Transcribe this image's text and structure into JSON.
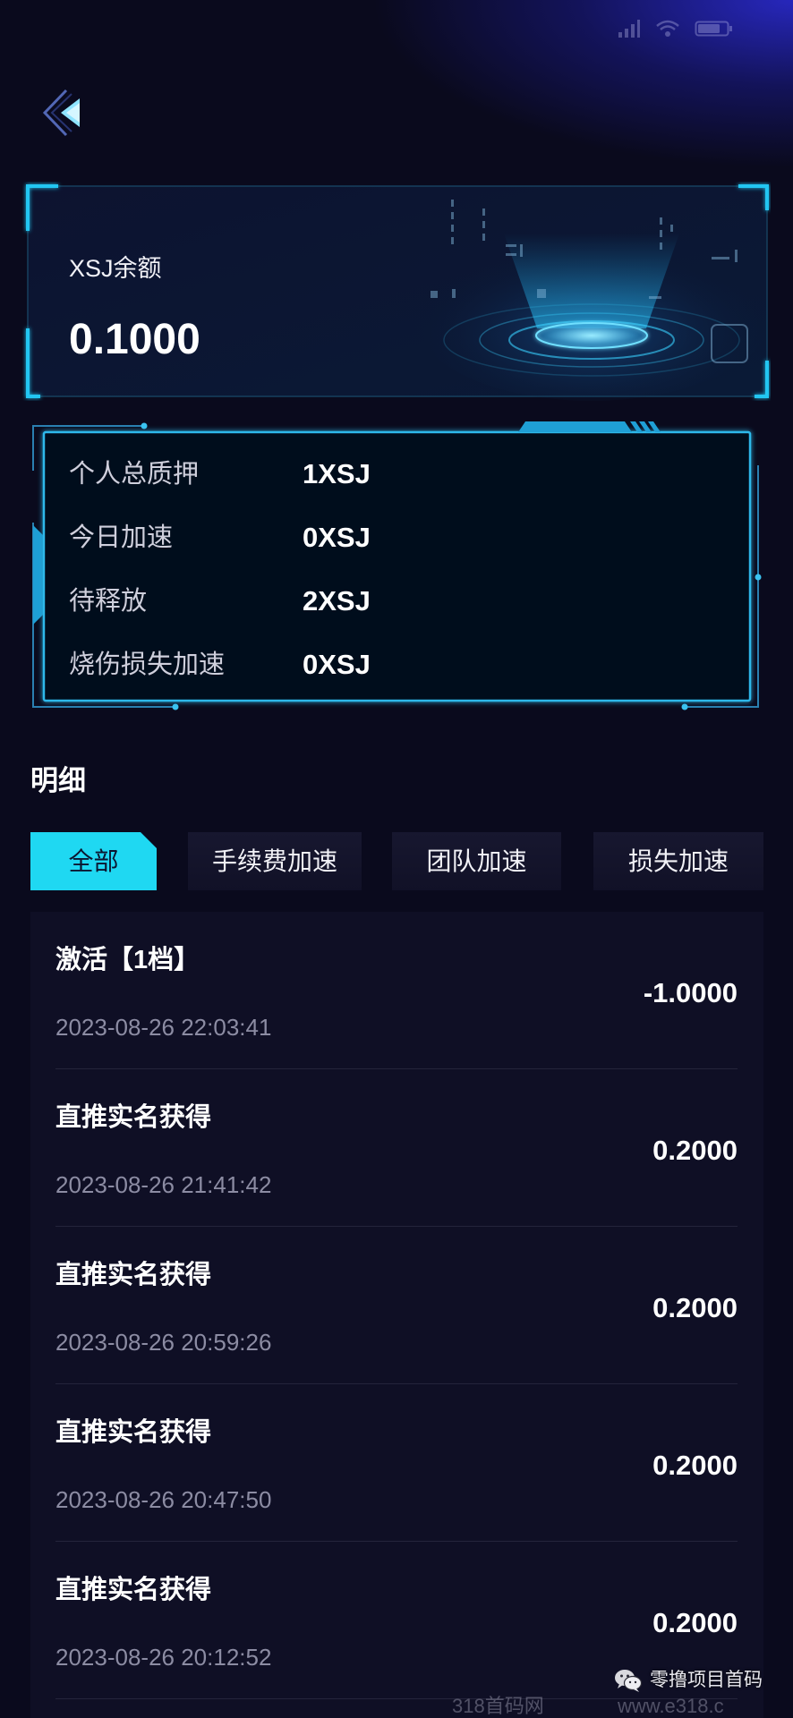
{
  "status_bar": {
    "icons": [
      "signal-icon",
      "wifi-icon",
      "battery-icon"
    ]
  },
  "nav": {
    "back_icon": "back-arrow-icon"
  },
  "balance": {
    "label": "XSJ余额",
    "value": "0.1000"
  },
  "stats": [
    {
      "label": "个人总质押",
      "value": "1XSJ"
    },
    {
      "label": "今日加速",
      "value": "0XSJ"
    },
    {
      "label": "待释放",
      "value": "2XSJ"
    },
    {
      "label": "烧伤损失加速",
      "value": "0XSJ"
    }
  ],
  "details": {
    "title": "明细",
    "tabs": [
      {
        "label": "全部",
        "active": true
      },
      {
        "label": "手续费加速",
        "active": false
      },
      {
        "label": "团队加速",
        "active": false
      },
      {
        "label": "损失加速",
        "active": false
      }
    ],
    "records": [
      {
        "title": "激活【1档】",
        "time": "2023-08-26 22:03:41",
        "amount": "-1.0000"
      },
      {
        "title": "直推实名获得",
        "time": "2023-08-26 21:41:42",
        "amount": "0.2000"
      },
      {
        "title": "直推实名获得",
        "time": "2023-08-26 20:59:26",
        "amount": "0.2000"
      },
      {
        "title": "直推实名获得",
        "time": "2023-08-26 20:47:50",
        "amount": "0.2000"
      },
      {
        "title": "直推实名获得",
        "time": "2023-08-26 20:12:52",
        "amount": "0.2000"
      }
    ]
  },
  "watermark": {
    "icon": "wechat-icon",
    "account": "零撸项目首码",
    "site_name": "318首码网",
    "site_url": "www.e318.c"
  },
  "colors": {
    "background": "#0a0a1d",
    "accent": "#1fd8f2",
    "frame": "#2fb8ea",
    "text": "#ffffff",
    "muted": "#8c8ca3",
    "panel": "#0f0f25"
  }
}
